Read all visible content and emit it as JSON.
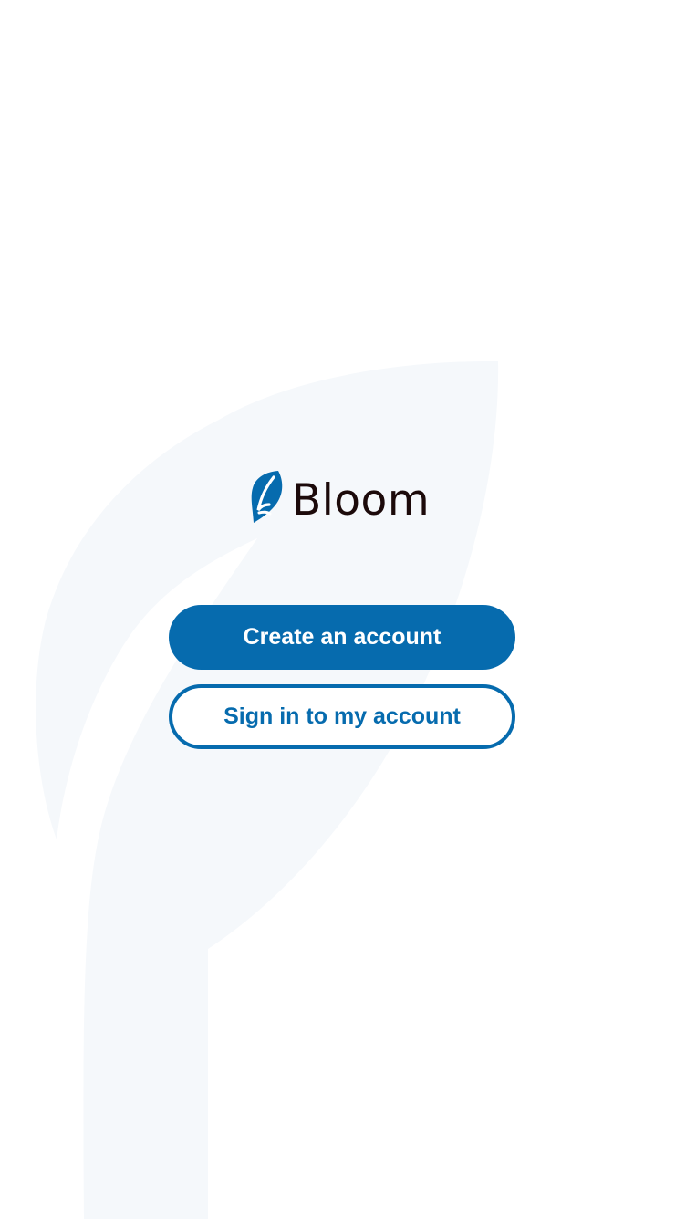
{
  "app": {
    "name": "Bloom"
  },
  "actions": {
    "create_account_label": "Create an account",
    "sign_in_label": "Sign in to my account"
  },
  "colors": {
    "brand_blue": "#066bae",
    "logo_text": "#1c0a0a",
    "background_leaf": "#f5f8fb",
    "background": "#ffffff"
  },
  "icons": {
    "logo": "leaf-icon",
    "background": "leaf-icon"
  }
}
